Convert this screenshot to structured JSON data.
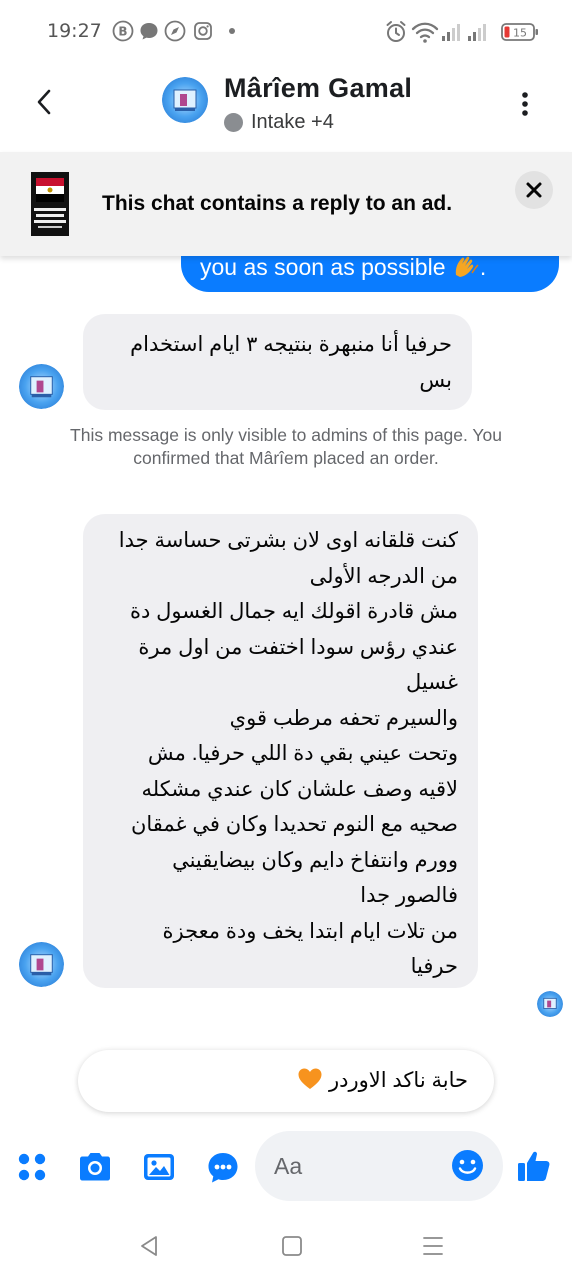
{
  "status_bar": {
    "time": "19:27",
    "battery": "15",
    "notification_icons": [
      "b-circle-icon",
      "speech-bubble-icon",
      "compass-icon",
      "instagram-icon",
      "dot-icon"
    ],
    "system_icons": [
      "alarm-icon",
      "wifi-icon",
      "signal-icon",
      "signal-icon",
      "battery-icon"
    ]
  },
  "header": {
    "name": "Mârîem Gamal",
    "subtitle": "Intake +4"
  },
  "ad_banner": {
    "text": "This chat contains a reply to an ad."
  },
  "messages": {
    "outgoing_partial": "you as soon as possible",
    "incoming_1_lines": [
      "حرفيا أنا منبهرة بنتيجه ٣ ايام استخدام",
      "بس"
    ],
    "notice": "This message is only visible to admins of this page. You confirmed that Mârîem placed an order.",
    "incoming_2_lines": [
      "كنت قلقانه اوى لان بشرتى حساسة جدا",
      "من الدرجه الأولى",
      "مش قادرة اقولك ايه جمال الغسول دة",
      "عندي رؤس سودا  اختفت من اول مرة",
      "غسيل",
      "والسيرم تحفه مرطب قوي",
      "وتحت عيني بقي دة اللي حرفيا. مش",
      "لاقيه وصف علشان كان عندي مشكله",
      "صحيه مع النوم  تحديدا وكان في غمقان",
      "وورم وانتفاخ دايم وكان بيضايقيني",
      "فالصور جدا",
      "من تلات ايام  ابتدا يخف ودة معجزة",
      "حرفيا"
    ]
  },
  "draft_reply": {
    "text": "حابة ناكد الاوردر"
  },
  "composer": {
    "placeholder": "Aa"
  },
  "colors": {
    "brand_blue": "#0a7cff",
    "incoming_bubble": "#efeff2",
    "secondary_text": "#65676b",
    "banner_bg": "#f2f2f2"
  }
}
